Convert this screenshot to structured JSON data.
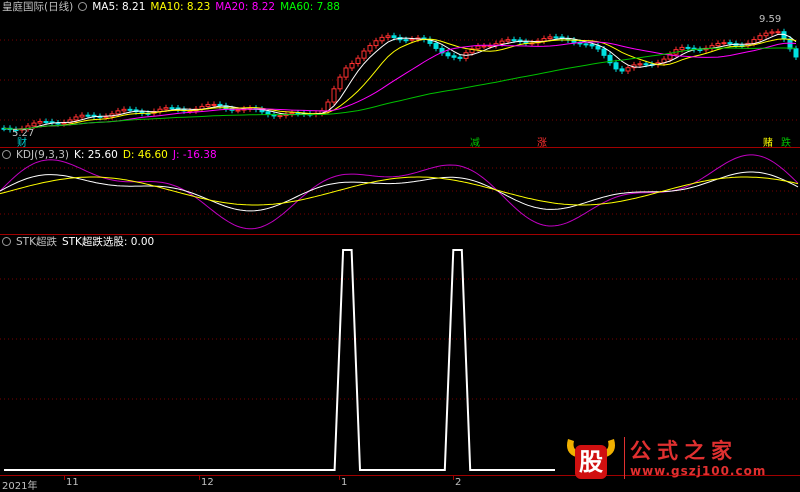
{
  "main": {
    "title": "皇庭国际(日线)",
    "ma": [
      {
        "label": "MA5: 8.21",
        "color": "#ffffff"
      },
      {
        "label": "MA10: 8.23",
        "color": "#ffff00"
      },
      {
        "label": "MA20: 8.22",
        "color": "#ff00ff"
      },
      {
        "label": "MA60: 7.88",
        "color": "#00ff00"
      }
    ],
    "high_label": "9.59",
    "low_label": "5.27",
    "signals": [
      {
        "text": "财",
        "color": "#00d0d0"
      },
      {
        "text": "减",
        "color": "#00c000"
      },
      {
        "text": "涨",
        "color": "#ff3030"
      },
      {
        "text": "赌",
        "color": "#ffff00"
      },
      {
        "text": "跌",
        "color": "#00c000"
      }
    ]
  },
  "kdj": {
    "title": "KDJ(9,3,3)",
    "k": {
      "label": "K: 25.60",
      "color": "#ffffff"
    },
    "d": {
      "label": "D: 46.60",
      "color": "#ffff00"
    },
    "j": {
      "label": "J: -16.38",
      "color": "#ff00ff"
    }
  },
  "stk": {
    "title": "STK超跌",
    "value": "STK超跌选股: 0.00"
  },
  "axis": {
    "labels": [
      "2021年",
      "11",
      "12",
      "1",
      "2"
    ]
  },
  "watermark": {
    "logo_char": "股",
    "title": "公式之家",
    "url": "www.gszj100.com"
  },
  "chart_data": [
    {
      "type": "line",
      "title": "STK超跌选股",
      "series": [
        {
          "name": "STK超跌选股",
          "values": [
            0,
            0,
            0,
            0,
            0,
            0,
            0,
            0,
            0,
            0,
            0,
            0,
            0,
            0,
            0,
            0,
            0,
            0,
            0,
            0,
            0,
            0,
            0,
            0,
            0,
            0,
            0,
            0,
            0,
            0,
            0,
            0,
            0,
            0,
            0,
            0,
            0,
            0,
            0,
            0,
            1,
            1,
            0,
            0,
            0,
            0,
            0,
            0,
            0,
            0,
            0,
            0,
            0,
            1,
            1,
            0,
            0,
            0,
            0,
            0,
            0,
            0,
            0,
            0,
            0,
            0
          ]
        }
      ],
      "ylim": [
        0,
        1
      ]
    }
  ]
}
